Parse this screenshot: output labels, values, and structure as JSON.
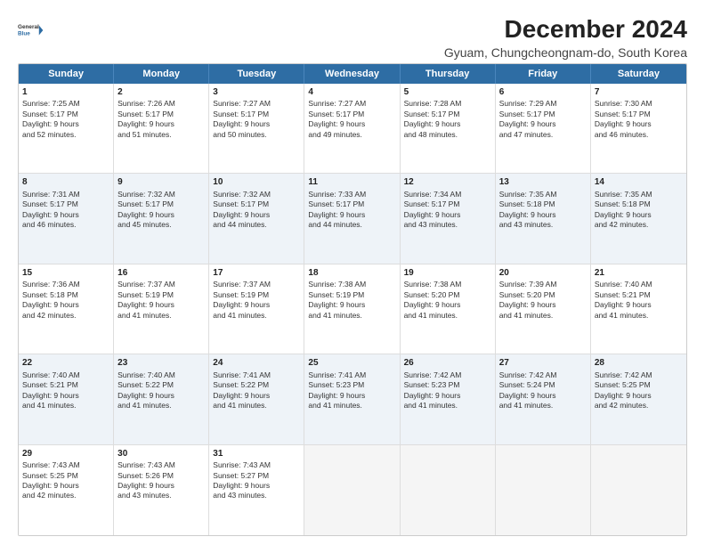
{
  "logo": {
    "line1": "General",
    "line2": "Blue"
  },
  "title": "December 2024",
  "subtitle": "Gyuam, Chungcheongnam-do, South Korea",
  "weekdays": [
    "Sunday",
    "Monday",
    "Tuesday",
    "Wednesday",
    "Thursday",
    "Friday",
    "Saturday"
  ],
  "rows": [
    [
      {
        "day": "1",
        "lines": [
          "Sunrise: 7:25 AM",
          "Sunset: 5:17 PM",
          "Daylight: 9 hours",
          "and 52 minutes."
        ]
      },
      {
        "day": "2",
        "lines": [
          "Sunrise: 7:26 AM",
          "Sunset: 5:17 PM",
          "Daylight: 9 hours",
          "and 51 minutes."
        ]
      },
      {
        "day": "3",
        "lines": [
          "Sunrise: 7:27 AM",
          "Sunset: 5:17 PM",
          "Daylight: 9 hours",
          "and 50 minutes."
        ]
      },
      {
        "day": "4",
        "lines": [
          "Sunrise: 7:27 AM",
          "Sunset: 5:17 PM",
          "Daylight: 9 hours",
          "and 49 minutes."
        ]
      },
      {
        "day": "5",
        "lines": [
          "Sunrise: 7:28 AM",
          "Sunset: 5:17 PM",
          "Daylight: 9 hours",
          "and 48 minutes."
        ]
      },
      {
        "day": "6",
        "lines": [
          "Sunrise: 7:29 AM",
          "Sunset: 5:17 PM",
          "Daylight: 9 hours",
          "and 47 minutes."
        ]
      },
      {
        "day": "7",
        "lines": [
          "Sunrise: 7:30 AM",
          "Sunset: 5:17 PM",
          "Daylight: 9 hours",
          "and 46 minutes."
        ]
      }
    ],
    [
      {
        "day": "8",
        "lines": [
          "Sunrise: 7:31 AM",
          "Sunset: 5:17 PM",
          "Daylight: 9 hours",
          "and 46 minutes."
        ]
      },
      {
        "day": "9",
        "lines": [
          "Sunrise: 7:32 AM",
          "Sunset: 5:17 PM",
          "Daylight: 9 hours",
          "and 45 minutes."
        ]
      },
      {
        "day": "10",
        "lines": [
          "Sunrise: 7:32 AM",
          "Sunset: 5:17 PM",
          "Daylight: 9 hours",
          "and 44 minutes."
        ]
      },
      {
        "day": "11",
        "lines": [
          "Sunrise: 7:33 AM",
          "Sunset: 5:17 PM",
          "Daylight: 9 hours",
          "and 44 minutes."
        ]
      },
      {
        "day": "12",
        "lines": [
          "Sunrise: 7:34 AM",
          "Sunset: 5:17 PM",
          "Daylight: 9 hours",
          "and 43 minutes."
        ]
      },
      {
        "day": "13",
        "lines": [
          "Sunrise: 7:35 AM",
          "Sunset: 5:18 PM",
          "Daylight: 9 hours",
          "and 43 minutes."
        ]
      },
      {
        "day": "14",
        "lines": [
          "Sunrise: 7:35 AM",
          "Sunset: 5:18 PM",
          "Daylight: 9 hours",
          "and 42 minutes."
        ]
      }
    ],
    [
      {
        "day": "15",
        "lines": [
          "Sunrise: 7:36 AM",
          "Sunset: 5:18 PM",
          "Daylight: 9 hours",
          "and 42 minutes."
        ]
      },
      {
        "day": "16",
        "lines": [
          "Sunrise: 7:37 AM",
          "Sunset: 5:19 PM",
          "Daylight: 9 hours",
          "and 41 minutes."
        ]
      },
      {
        "day": "17",
        "lines": [
          "Sunrise: 7:37 AM",
          "Sunset: 5:19 PM",
          "Daylight: 9 hours",
          "and 41 minutes."
        ]
      },
      {
        "day": "18",
        "lines": [
          "Sunrise: 7:38 AM",
          "Sunset: 5:19 PM",
          "Daylight: 9 hours",
          "and 41 minutes."
        ]
      },
      {
        "day": "19",
        "lines": [
          "Sunrise: 7:38 AM",
          "Sunset: 5:20 PM",
          "Daylight: 9 hours",
          "and 41 minutes."
        ]
      },
      {
        "day": "20",
        "lines": [
          "Sunrise: 7:39 AM",
          "Sunset: 5:20 PM",
          "Daylight: 9 hours",
          "and 41 minutes."
        ]
      },
      {
        "day": "21",
        "lines": [
          "Sunrise: 7:40 AM",
          "Sunset: 5:21 PM",
          "Daylight: 9 hours",
          "and 41 minutes."
        ]
      }
    ],
    [
      {
        "day": "22",
        "lines": [
          "Sunrise: 7:40 AM",
          "Sunset: 5:21 PM",
          "Daylight: 9 hours",
          "and 41 minutes."
        ]
      },
      {
        "day": "23",
        "lines": [
          "Sunrise: 7:40 AM",
          "Sunset: 5:22 PM",
          "Daylight: 9 hours",
          "and 41 minutes."
        ]
      },
      {
        "day": "24",
        "lines": [
          "Sunrise: 7:41 AM",
          "Sunset: 5:22 PM",
          "Daylight: 9 hours",
          "and 41 minutes."
        ]
      },
      {
        "day": "25",
        "lines": [
          "Sunrise: 7:41 AM",
          "Sunset: 5:23 PM",
          "Daylight: 9 hours",
          "and 41 minutes."
        ]
      },
      {
        "day": "26",
        "lines": [
          "Sunrise: 7:42 AM",
          "Sunset: 5:23 PM",
          "Daylight: 9 hours",
          "and 41 minutes."
        ]
      },
      {
        "day": "27",
        "lines": [
          "Sunrise: 7:42 AM",
          "Sunset: 5:24 PM",
          "Daylight: 9 hours",
          "and 41 minutes."
        ]
      },
      {
        "day": "28",
        "lines": [
          "Sunrise: 7:42 AM",
          "Sunset: 5:25 PM",
          "Daylight: 9 hours",
          "and 42 minutes."
        ]
      }
    ],
    [
      {
        "day": "29",
        "lines": [
          "Sunrise: 7:43 AM",
          "Sunset: 5:25 PM",
          "Daylight: 9 hours",
          "and 42 minutes."
        ]
      },
      {
        "day": "30",
        "lines": [
          "Sunrise: 7:43 AM",
          "Sunset: 5:26 PM",
          "Daylight: 9 hours",
          "and 43 minutes."
        ]
      },
      {
        "day": "31",
        "lines": [
          "Sunrise: 7:43 AM",
          "Sunset: 5:27 PM",
          "Daylight: 9 hours",
          "and 43 minutes."
        ]
      },
      {
        "day": "",
        "lines": []
      },
      {
        "day": "",
        "lines": []
      },
      {
        "day": "",
        "lines": []
      },
      {
        "day": "",
        "lines": []
      }
    ]
  ]
}
